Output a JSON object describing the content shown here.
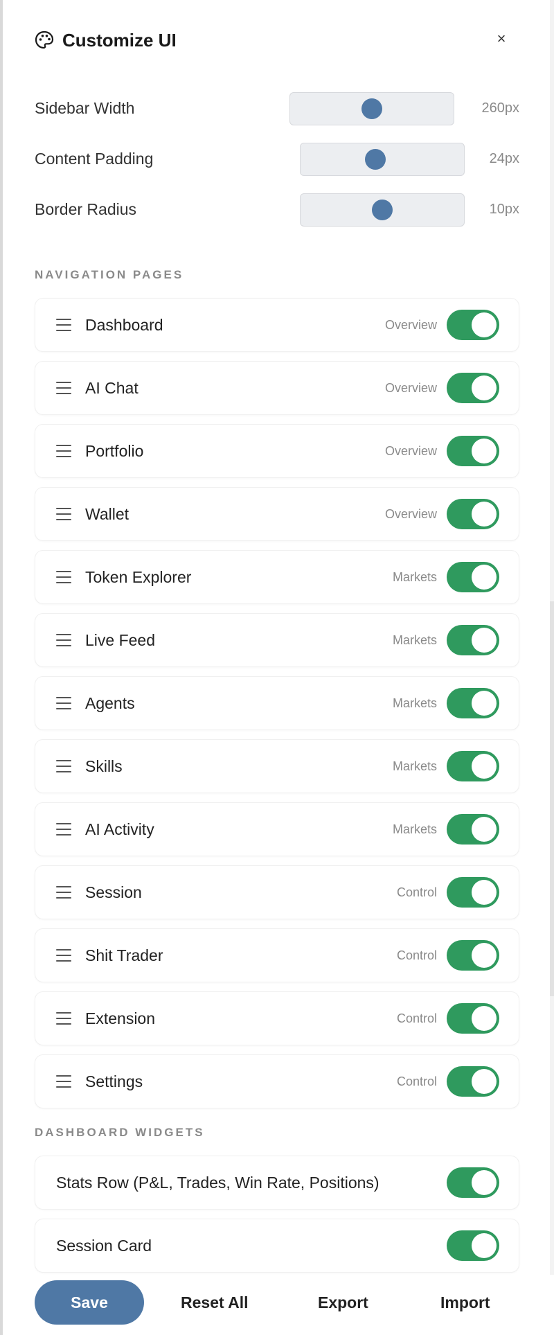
{
  "header": {
    "title": "Customize UI",
    "icon": "palette-icon",
    "close_label": "×"
  },
  "sliders": [
    {
      "label": "Sidebar Width",
      "value": "260px",
      "level": 0.5
    },
    {
      "label": "Content Padding",
      "value": "24px",
      "level": 0.45
    },
    {
      "label": "Border Radius",
      "value": "10px",
      "level": 0.5
    }
  ],
  "navigation": {
    "heading": "NAVIGATION PAGES",
    "items": [
      {
        "label": "Dashboard",
        "group": "Overview",
        "enabled": true
      },
      {
        "label": "AI Chat",
        "group": "Overview",
        "enabled": true
      },
      {
        "label": "Portfolio",
        "group": "Overview",
        "enabled": true
      },
      {
        "label": "Wallet",
        "group": "Overview",
        "enabled": true
      },
      {
        "label": "Token Explorer",
        "group": "Markets",
        "enabled": true
      },
      {
        "label": "Live Feed",
        "group": "Markets",
        "enabled": true
      },
      {
        "label": "Agents",
        "group": "Markets",
        "enabled": true
      },
      {
        "label": "Skills",
        "group": "Markets",
        "enabled": true
      },
      {
        "label": "AI Activity",
        "group": "Markets",
        "enabled": true
      },
      {
        "label": "Session",
        "group": "Control",
        "enabled": true
      },
      {
        "label": "Shit Trader",
        "group": "Control",
        "enabled": true
      },
      {
        "label": "Extension",
        "group": "Control",
        "enabled": true
      },
      {
        "label": "Settings",
        "group": "Control",
        "enabled": true
      }
    ]
  },
  "widgets": {
    "heading": "DASHBOARD WIDGETS",
    "items": [
      {
        "label": "Stats Row (P&L, Trades, Win Rate, Positions)",
        "enabled": true
      },
      {
        "label": "Session Card",
        "enabled": true
      }
    ]
  },
  "footer": {
    "save_label": "Save",
    "reset_label": "Reset All",
    "export_label": "Export",
    "import_label": "Import"
  },
  "colors": {
    "accent": "#4f78a5",
    "toggle_on": "#2f9a5e"
  }
}
